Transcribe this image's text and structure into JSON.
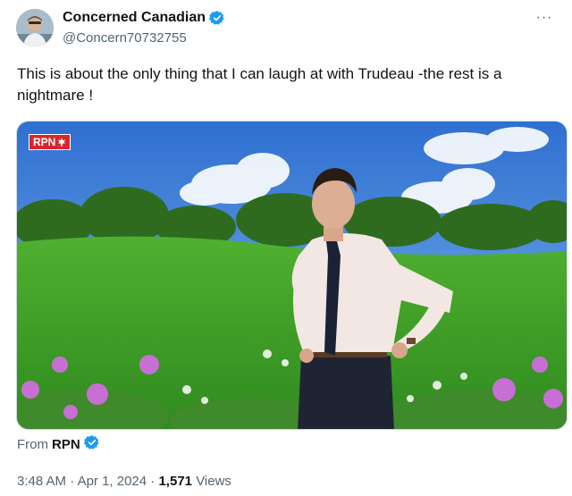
{
  "author": {
    "display_name": "Concerned Canadian",
    "handle": "@Concern70732755",
    "verified_icon": "verified-badge-icon",
    "badge_color": "#1d9bf0"
  },
  "more_menu": {
    "glyph": "···"
  },
  "tweet": {
    "text": "This is about the only thing that I can laugh at with Trudeau -the rest is a nightmare !"
  },
  "media": {
    "overlay_badge": "RPN",
    "overlay_badge_icon": "maple-leaf-icon"
  },
  "source": {
    "prefix": "From",
    "name": "RPN"
  },
  "meta": {
    "time": "3:48 AM",
    "sep1": "·",
    "date": "Apr 1, 2024",
    "sep2": "·",
    "views_count": "1,571",
    "views_label": "Views"
  }
}
